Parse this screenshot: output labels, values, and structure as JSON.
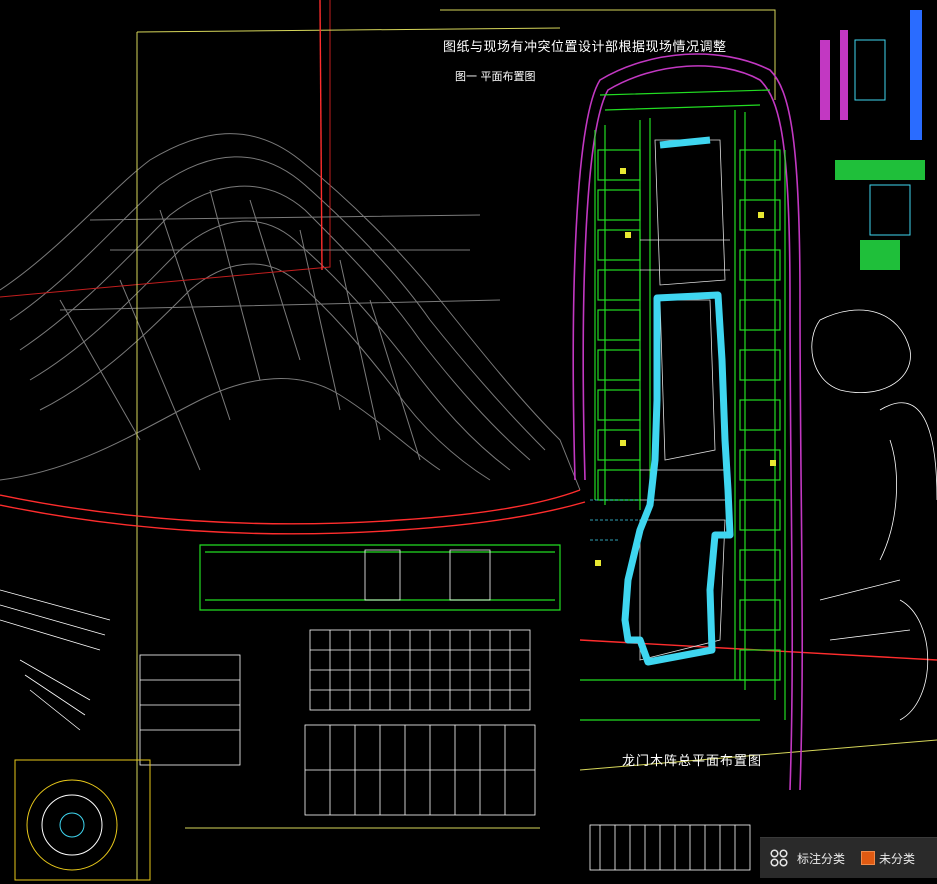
{
  "drawing": {
    "note_line1": "图纸与现场有冲突位置设计部根据现场情况调整",
    "note_line2": "图一 平面布置图",
    "plan_title": "龙门木阵总平面布置图"
  },
  "toolbar": {
    "annotate_label": "标注分类",
    "annotate_icon": "four-circles-icon",
    "uncategorized_label": "未分类",
    "uncategorized_color": "#e05a12"
  },
  "colors": {
    "background": "#000000",
    "terrain": "#7a7a7a",
    "boundary": "#e2e25a",
    "road": "#ff2d2d",
    "building_green": "#22dd22",
    "water": "#3fd6f0",
    "magenta": "#c238c2",
    "parking": "#ffffff"
  }
}
